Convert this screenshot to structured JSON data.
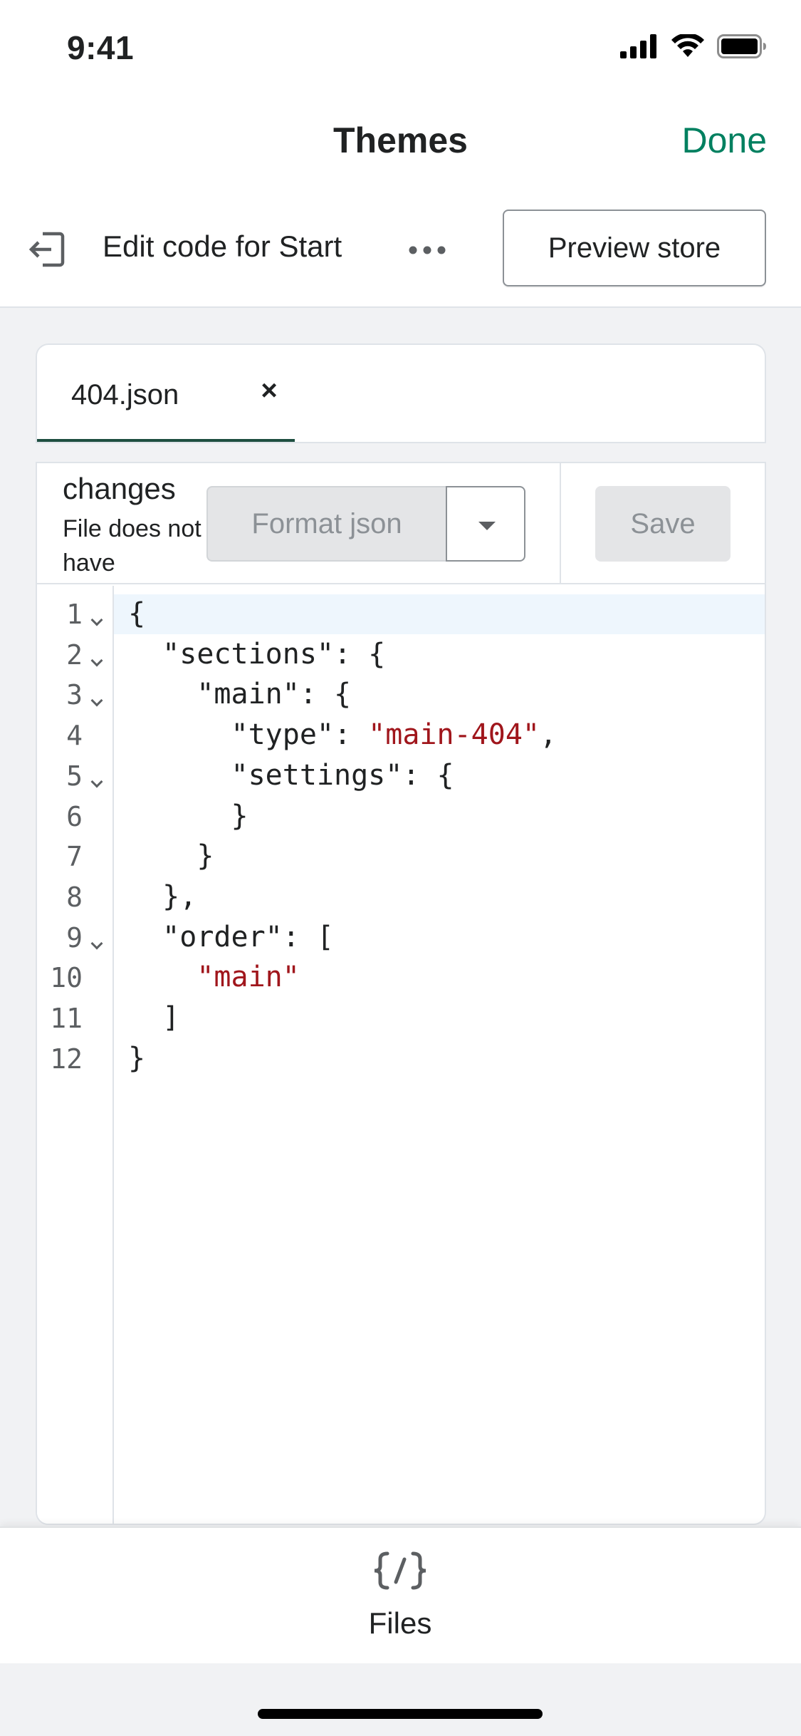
{
  "status_bar": {
    "time": "9:41",
    "icons": [
      "cellular-signal-icon",
      "wifi-icon",
      "battery-icon"
    ]
  },
  "header": {
    "title": "Themes",
    "done_label": "Done",
    "done_color": "#008060"
  },
  "toolbar": {
    "exit_icon": "exit-icon",
    "label": "Edit code for Start",
    "more_icon": "more-horizontal-icon",
    "preview_label": "Preview store"
  },
  "tabs": [
    {
      "label": "404.json",
      "close_glyph": "×",
      "active": true
    }
  ],
  "editor_toolbar": {
    "change_title": "changes",
    "change_desc": "File does not have",
    "format_label": "Format json",
    "save_label": "Save"
  },
  "code": {
    "active_line": 1,
    "lines": [
      {
        "num": "1",
        "fold": true,
        "parts": [
          {
            "t": "{",
            "c": "p"
          }
        ]
      },
      {
        "num": "2",
        "fold": true,
        "parts": [
          {
            "t": "  \"sections\": {",
            "c": "p"
          }
        ]
      },
      {
        "num": "3",
        "fold": true,
        "parts": [
          {
            "t": "    \"main\": {",
            "c": "p"
          }
        ]
      },
      {
        "num": "4",
        "fold": false,
        "parts": [
          {
            "t": "      \"type\": ",
            "c": "p"
          },
          {
            "t": "\"main-404\"",
            "c": "s"
          },
          {
            "t": ",",
            "c": "p"
          }
        ]
      },
      {
        "num": "5",
        "fold": true,
        "parts": [
          {
            "t": "      \"settings\": {",
            "c": "p"
          }
        ]
      },
      {
        "num": "6",
        "fold": false,
        "parts": [
          {
            "t": "      }",
            "c": "p"
          }
        ]
      },
      {
        "num": "7",
        "fold": false,
        "parts": [
          {
            "t": "    }",
            "c": "p"
          }
        ]
      },
      {
        "num": "8",
        "fold": false,
        "parts": [
          {
            "t": "  },",
            "c": "p"
          }
        ]
      },
      {
        "num": "9",
        "fold": true,
        "parts": [
          {
            "t": "  \"order\": [",
            "c": "p"
          }
        ]
      },
      {
        "num": "10",
        "fold": false,
        "parts": [
          {
            "t": "    ",
            "c": "p"
          },
          {
            "t": "\"main\"",
            "c": "s"
          }
        ]
      },
      {
        "num": "11",
        "fold": false,
        "parts": [
          {
            "t": "  ]",
            "c": "p"
          }
        ]
      },
      {
        "num": "12",
        "fold": false,
        "parts": [
          {
            "t": "}",
            "c": "p"
          }
        ]
      }
    ]
  },
  "bottom_nav": {
    "files_icon": "code-braces-icon",
    "files_label": "Files"
  }
}
